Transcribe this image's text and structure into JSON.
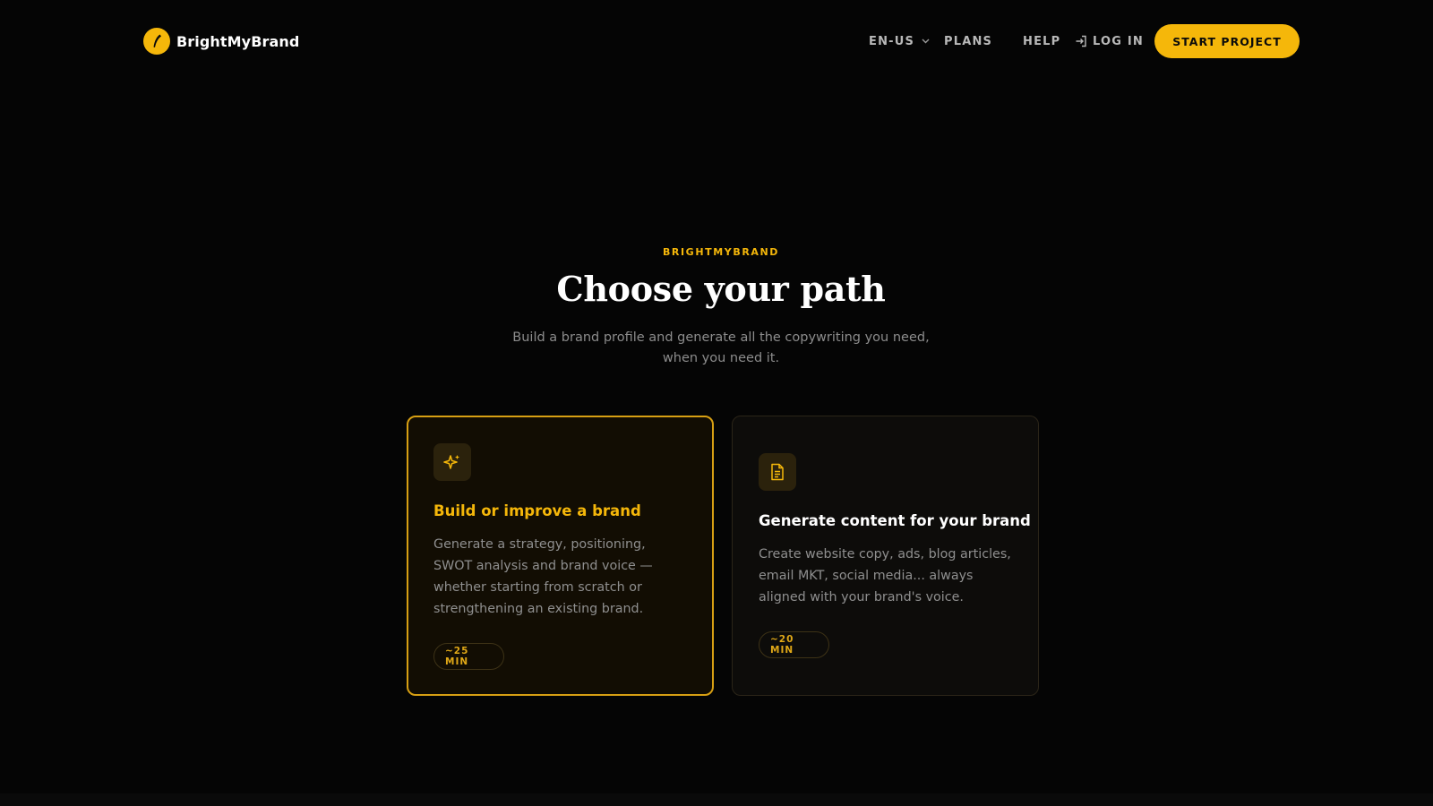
{
  "header": {
    "brand_name": "BrightMyBrand",
    "logo_icon": "feather-pen-icon",
    "nav": {
      "language": "EN-US",
      "plans": "PLANS",
      "help": "HELP",
      "login": "LOG IN",
      "start_project": "START PROJECT"
    }
  },
  "hero": {
    "eyebrow": "BRIGHTMYBRAND",
    "title": "Choose your path",
    "subtitle": "Build a brand profile and generate all the copywriting you need, when you need it."
  },
  "cards": [
    {
      "icon": "sparkles-icon",
      "title": "Build or improve a brand",
      "description": "Generate a strategy, positioning, SWOT analysis and brand voice — whether starting from scratch or strengthening an existing brand.",
      "duration": "~25 MIN",
      "selected": true
    },
    {
      "icon": "document-icon",
      "title": "Generate content for your brand",
      "description": "Create website copy, ads, blog articles, email MKT, social media... always aligned with your brand's voice.",
      "duration": "~20 MIN",
      "selected": false
    }
  ],
  "colors": {
    "accent": "#f5b70a",
    "background": "#050505",
    "selected_card_border": "#d79f13",
    "muted_text": "#8f8f8f"
  }
}
